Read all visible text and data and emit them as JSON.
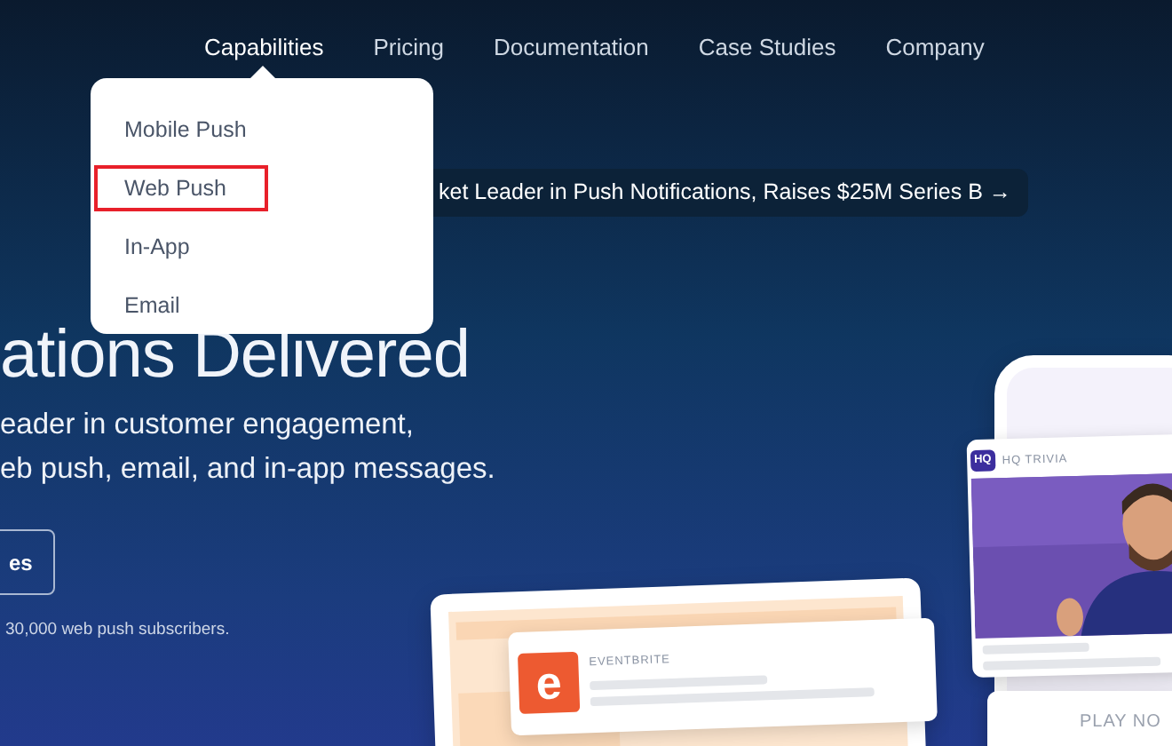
{
  "nav": {
    "items": [
      {
        "label": "Capabilities",
        "selected": true
      },
      {
        "label": "Pricing",
        "selected": false
      },
      {
        "label": "Documentation",
        "selected": false
      },
      {
        "label": "Case Studies",
        "selected": false
      },
      {
        "label": "Company",
        "selected": false
      }
    ]
  },
  "dropdown": {
    "items": [
      {
        "label": "Mobile Push",
        "selected": false
      },
      {
        "label": "Web Push",
        "selected": true
      },
      {
        "label": "In-App",
        "selected": false
      },
      {
        "label": "Email",
        "selected": false
      }
    ]
  },
  "announcement": "ket Leader in Push Notifications, Raises $25M Series B →",
  "hero": {
    "heading": "ations Delivered",
    "lines": [
      "eader in customer engagement,",
      "eb push, email, and in-app messages."
    ],
    "button": "es",
    "caption": "30,000 web push subscribers."
  },
  "laptop_notification": {
    "logo": "e",
    "app": "EVENTBRITE"
  },
  "phone_notification": {
    "logo": "HQ",
    "app": "HQ TRIVIA",
    "action": "PLAY NO"
  }
}
